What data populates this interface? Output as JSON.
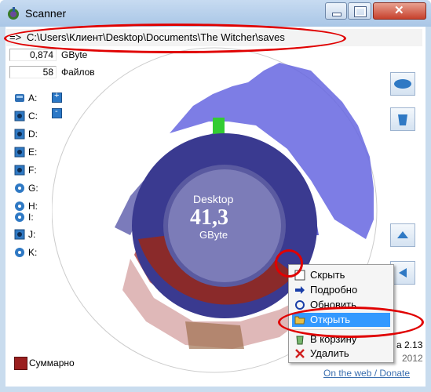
{
  "window": {
    "title": "Scanner"
  },
  "path_bar": {
    "arrow": "=>",
    "path": "C:\\Users\\Клиент\\Desktop\\Documents\\The Witcher\\saves"
  },
  "stats": {
    "size_value": "0,874",
    "size_unit": "GByte",
    "files_value": "58",
    "files_label": "Файлов"
  },
  "drives": [
    "A:",
    "C:",
    "D:",
    "E:",
    "F:",
    "G:",
    "H:",
    "I:",
    "J:",
    "K:"
  ],
  "center": {
    "name": "Desktop",
    "value": "41,3",
    "unit": "GByte"
  },
  "context_menu": {
    "items": [
      {
        "label": "Скрыть",
        "icon": "hide-icon"
      },
      {
        "label": "Подробно",
        "icon": "arrow-right-icon"
      },
      {
        "label": "Обновить",
        "icon": "refresh-icon"
      },
      {
        "label": "Открыть",
        "icon": "folder-open-icon",
        "selected": true
      },
      {
        "label": "В корзину",
        "icon": "recycle-bin-icon"
      },
      {
        "label": "Удалить",
        "icon": "delete-x-icon"
      }
    ]
  },
  "legend": {
    "label": "Суммарно",
    "color": "#9a1f1f"
  },
  "footer": {
    "version_partial_1": "а 2.13",
    "version_partial_2": "2012",
    "web_link": "On the web / Donate"
  },
  "colors": {
    "titlebar": "#b8d1ec",
    "selection": "#3399ff",
    "annotation": "#e00000"
  }
}
